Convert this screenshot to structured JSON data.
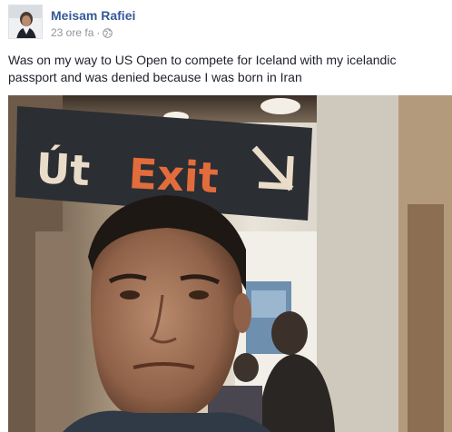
{
  "post": {
    "author": "Meisam Rafiei",
    "timestamp": "23 ore fa",
    "separator": "·",
    "privacy_icon": "globe-icon",
    "text": "Was on my way to US Open to compete for Iceland with my icelandic passport and was denied because I was born in Iran"
  },
  "photo": {
    "sign_word_icelandic": "Út",
    "sign_word_english": "Exit",
    "sign_arrow_icon": "arrow-down-right-icon"
  },
  "colors": {
    "author_link": "#365899",
    "meta_text": "#90949c",
    "body_text": "#1d2129",
    "sign_background": "#2b2e33",
    "sign_exit": "#e26c3c",
    "sign_ut": "#e9ddc9"
  }
}
